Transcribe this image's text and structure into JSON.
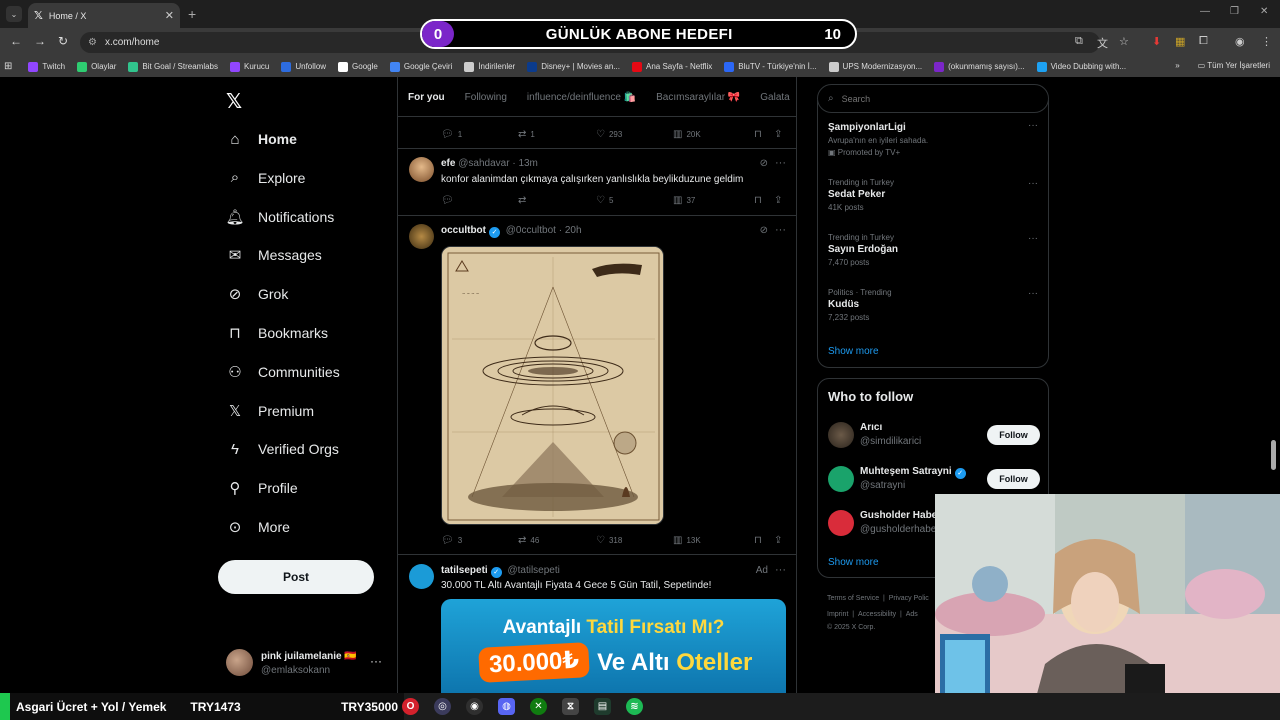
{
  "browser": {
    "tab_title": "Home / X",
    "url": "x.com/home",
    "bookmarks": [
      {
        "label": "Twitch",
        "color": "#9146ff"
      },
      {
        "label": "Olaylar",
        "color": "#2ecc71"
      },
      {
        "label": "Bit Goal / Streamlabs",
        "color": "#31c48d"
      },
      {
        "label": "Kurucu",
        "color": "#9146ff"
      },
      {
        "label": "Unfollow",
        "color": "#2d6cdf"
      },
      {
        "label": "Google",
        "color": "#ffffff"
      },
      {
        "label": "Google Çeviri",
        "color": "#4285f4"
      },
      {
        "label": "İndirilenler",
        "color": "#cccccc"
      },
      {
        "label": "Disney+ | Movies an...",
        "color": "#0b3b8c"
      },
      {
        "label": "Ana Sayfa - Netflix",
        "color": "#e50914"
      },
      {
        "label": "BluTV - Türkiye'nin İ...",
        "color": "#2b67f6"
      },
      {
        "label": "UPS Modernizasyon...",
        "color": "#cccccc"
      },
      {
        "label": "(okunmamış sayısı)...",
        "color": "#7b26c9"
      },
      {
        "label": "Video Dubbing with...",
        "color": "#1da1f2"
      }
    ],
    "bookmarks_more": "»",
    "all_bookmarks": "Tüm Yer İşaretleri"
  },
  "goal": {
    "current": "0",
    "title": "GÜNLÜK ABONE HEDEFI",
    "target": "10"
  },
  "nav": {
    "items": [
      {
        "label": "Home",
        "icon": "home-icon"
      },
      {
        "label": "Explore",
        "icon": "search-icon"
      },
      {
        "label": "Notifications",
        "icon": "bell-icon"
      },
      {
        "label": "Messages",
        "icon": "mail-icon"
      },
      {
        "label": "Grok",
        "icon": "grok-icon"
      },
      {
        "label": "Bookmarks",
        "icon": "bookmark-icon"
      },
      {
        "label": "Communities",
        "icon": "communities-icon"
      },
      {
        "label": "Premium",
        "icon": "x-icon"
      },
      {
        "label": "Verified Orgs",
        "icon": "bolt-icon"
      },
      {
        "label": "Profile",
        "icon": "person-icon"
      },
      {
        "label": "More",
        "icon": "more-circle-icon"
      }
    ],
    "post_label": "Post",
    "user": {
      "name": "pink juilamelanie 🇪🇸",
      "handle": "@emlaksokann"
    }
  },
  "timeline": {
    "tabs": [
      "For you",
      "Following",
      "influence/deinfluence 🛍️",
      "Bacımsaraylılar 🎀",
      "Galata"
    ],
    "prev_actions": {
      "replies": "1",
      "reposts": "1",
      "likes": "293",
      "views": "20K"
    },
    "tweet1": {
      "name": "efe",
      "handle": "@sahdavar",
      "time": "13m",
      "text": "konfor alanimdan çıkmaya çalışırken yanlıslıkla beylikduzune geldim",
      "replies": "",
      "reposts": "",
      "likes": "5",
      "views": "37"
    },
    "tweet2": {
      "name": "occultbot",
      "handle": "@0ccultbot",
      "time": "20h",
      "replies": "3",
      "reposts": "46",
      "likes": "318",
      "views": "13K"
    },
    "tweet3": {
      "name": "tatilsepeti",
      "handle": "@tatilsepeti",
      "ad": "Ad",
      "text": "30.000 TL Altı Avantajlı Fiyata 4 Gece 5 Gün Tatil, Sepetinde!",
      "ad_line1_a": "Avantajlı",
      "ad_line1_b": "Tatil Fırsatı Mı?",
      "ad_price": "30.000₺",
      "ad_rest_a": "Ve Altı",
      "ad_rest_b": "Oteller"
    }
  },
  "search": {
    "placeholder": "Search"
  },
  "trends": [
    {
      "context": "",
      "title": "ŞampiyonlarLigi",
      "sub": "Avrupa'nın en iyileri sahada.",
      "promo": "Promoted by TV+"
    },
    {
      "context": "Trending in Turkey",
      "title": "Sedat Peker",
      "sub": "41K posts"
    },
    {
      "context": "Trending in Turkey",
      "title": "Sayın Erdoğan",
      "sub": "7,470 posts"
    },
    {
      "context": "Politics · Trending",
      "title": "Kudüs",
      "sub": "7,232 posts"
    }
  ],
  "show_more": "Show more",
  "who_to_follow": {
    "title": "Who to follow",
    "people": [
      {
        "name": "Arıcı",
        "handle": "@simdilikarici",
        "follow": "Follow"
      },
      {
        "name": "Muhteşem Satrayni",
        "handle": "@satrayni",
        "follow": "Follow"
      },
      {
        "name": "Gusholder Habe",
        "handle": "@gusholderhabe",
        "follow": ""
      }
    ],
    "show_more": "Show more"
  },
  "footer": {
    "line1a": "Terms of Service",
    "line1b": "|",
    "line1c": "Privacy Polic",
    "line2a": "Imprint",
    "line2b": "|",
    "line2c": "Accessibility",
    "line2d": "|",
    "line2e": "Ads",
    "line3": "© 2025 X Corp."
  },
  "ticker": {
    "label": "Asgari Ücret + Yol / Yemek",
    "value1": "TRY1473",
    "value2": "TRY35000"
  }
}
